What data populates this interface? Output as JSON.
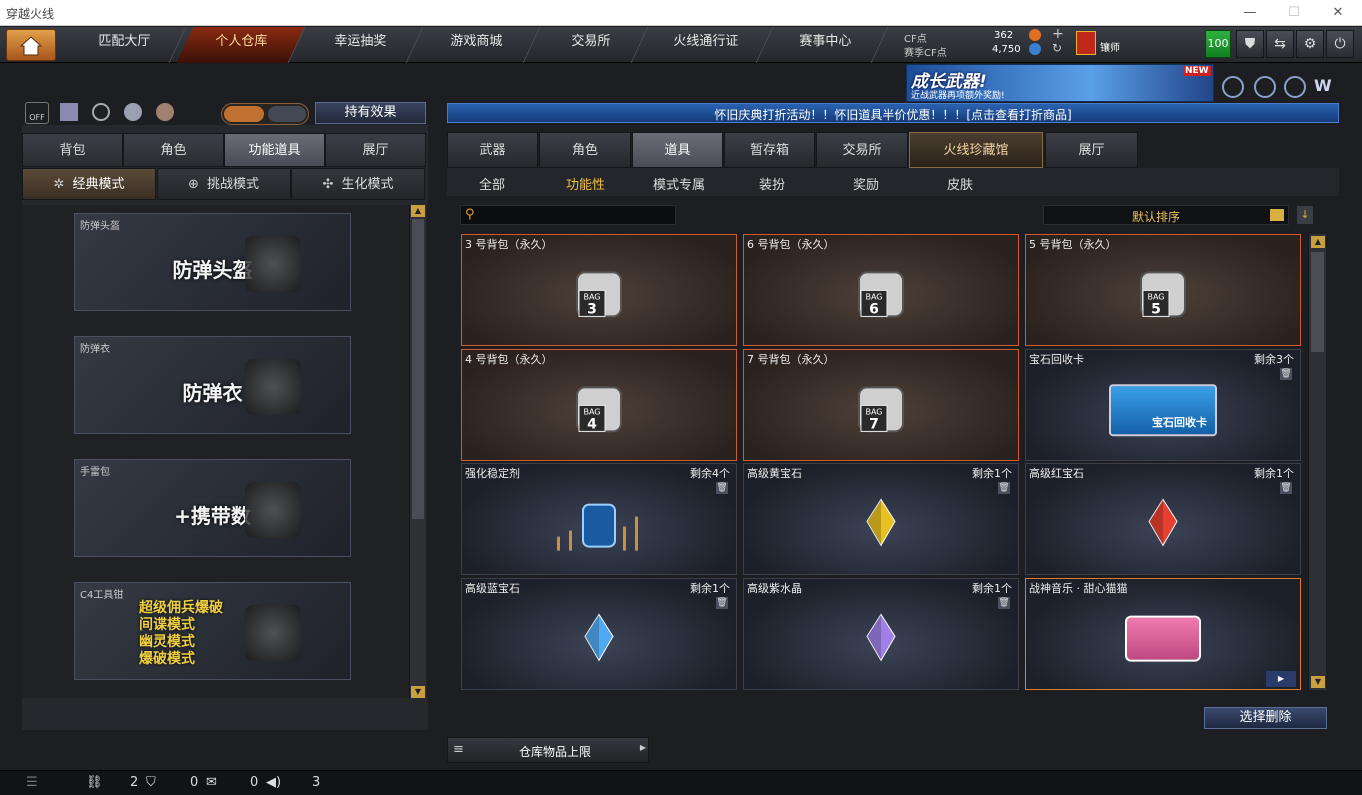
{
  "window": {
    "title": "穿越火线"
  },
  "nav": {
    "tabs": [
      "匹配大厅",
      "个人仓库",
      "幸运抽奖",
      "游戏商城",
      "交易所",
      "火线通行证",
      "赛事中心"
    ],
    "active_index": 1
  },
  "currency": {
    "cf_label": "CF点",
    "cf_value": "362",
    "match_label": "赛季CF点",
    "match_value": "4,750"
  },
  "user": {
    "rank_name": "镶师",
    "level": "100"
  },
  "banner": {
    "title": "成长武器!",
    "subtitle": "近战武器再项额外奖励!",
    "tag": "NEW"
  },
  "announce": {
    "text": "怀旧庆典打折活动！！怀旧道具半价优惠！！！[点击查看打折商品]"
  },
  "left": {
    "effect_button": "持有效果",
    "tabs": [
      "背包",
      "角色",
      "功能道具",
      "展厅"
    ],
    "active_tab": 2,
    "modes": [
      "经典模式",
      "挑战模式",
      "生化模式"
    ],
    "active_mode": 0,
    "cards": [
      {
        "label": "防弹头盔",
        "title": "防弹头盔"
      },
      {
        "label": "防弹衣",
        "title": "防弹衣"
      },
      {
        "label": "手雷包",
        "title": "+携带数"
      },
      {
        "label": "C4工具钳",
        "lines": [
          "超级佣兵爆破",
          "间谍模式",
          "幽灵模式",
          "爆破模式"
        ]
      }
    ]
  },
  "right": {
    "tabs": [
      "武器",
      "角色",
      "道具",
      "暂存箱",
      "交易所",
      "火线珍藏馆",
      "展厅"
    ],
    "active_tab": 2,
    "subtabs": [
      "全部",
      "功能性",
      "模式专属",
      "装扮",
      "奖励",
      "皮肤"
    ],
    "active_subtab": 1,
    "search_placeholder": "",
    "sort_label": "默认排序",
    "items": [
      {
        "name": "3 号背包（永久）",
        "count": "",
        "kind": "bag",
        "bagno": "3"
      },
      {
        "name": "6 号背包（永久）",
        "count": "",
        "kind": "bag",
        "bagno": "6"
      },
      {
        "name": "5 号背包（永久）",
        "count": "",
        "kind": "bag",
        "bagno": "5"
      },
      {
        "name": "4 号背包（永久）",
        "count": "",
        "kind": "bag",
        "bagno": "4"
      },
      {
        "name": "7 号背包（永久）",
        "count": "",
        "kind": "bag",
        "bagno": "7"
      },
      {
        "name": "宝石回收卡",
        "count": "剩余3个",
        "kind": "card",
        "card_text": "宝石回收卡"
      },
      {
        "name": "强化稳定剂",
        "count": "剩余4个",
        "kind": "jar"
      },
      {
        "name": "高级黄宝石",
        "count": "剩余1个",
        "kind": "gem",
        "color": "#e8c020"
      },
      {
        "name": "高级红宝石",
        "count": "剩余1个",
        "kind": "gem",
        "color": "#e84030"
      },
      {
        "name": "高级蓝宝石",
        "count": "剩余1个",
        "kind": "gem",
        "color": "#50a8f0"
      },
      {
        "name": "高级紫水晶",
        "count": "剩余1个",
        "kind": "gem",
        "color": "#a080e8"
      },
      {
        "name": "战神音乐 · 甜心猫猫",
        "count": "",
        "kind": "music"
      }
    ],
    "delete_button": "选择删除",
    "capacity_label": "仓库物品上限"
  },
  "bottom": {
    "a": "2",
    "b": "0",
    "c": "0",
    "d": "3"
  }
}
